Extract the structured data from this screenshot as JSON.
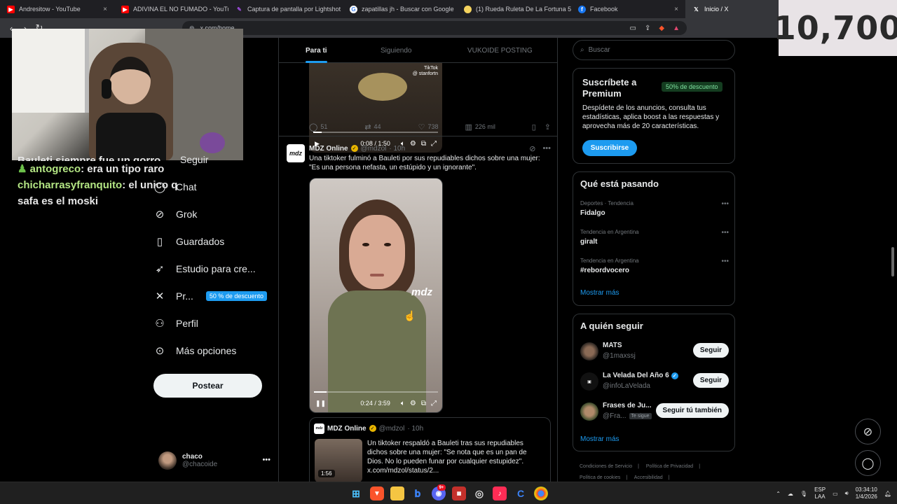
{
  "browser": {
    "tabs": [
      {
        "title": "Andresitow - YouTube",
        "favicon": "youtube-icon",
        "color": "#ff0000"
      },
      {
        "title": "ADIVINA EL NO FUMADO - YouTube",
        "favicon": "youtube-icon",
        "color": "#ff0000"
      },
      {
        "title": "Captura de pantalla por Lightshot",
        "favicon": "lightshot-icon",
        "color": "#a04ee0"
      },
      {
        "title": "zapatillas jh - Buscar con Google",
        "favicon": "google-icon",
        "color": "#ffffff"
      },
      {
        "title": "(1) Rueda Ruleta De La Fortuna 50 C",
        "favicon": "wheel-icon",
        "color": "#f4d35e"
      },
      {
        "title": "Facebook",
        "favicon": "facebook-icon",
        "color": "#1877f2"
      },
      {
        "title": "Inicio / X",
        "favicon": "x-icon",
        "color": "#000000",
        "active": true
      }
    ],
    "url": "x.com/home"
  },
  "overlay": {
    "score": "10,700",
    "chat": {
      "partial_line": "Bauleti siempre fue un gorro",
      "messages": [
        {
          "user": "antogreco",
          "text": ": era un tipo raro"
        },
        {
          "user": "chicharrasyfranquito",
          "text": ": el unico q safa es el moski"
        }
      ]
    }
  },
  "nav": {
    "items": [
      {
        "label": "Seguir",
        "icon": "follow-icon"
      },
      {
        "label": "Chat",
        "icon": "chat-icon"
      },
      {
        "label": "Grok",
        "icon": "grok-icon"
      },
      {
        "label": "Guardados",
        "icon": "bookmark-icon"
      },
      {
        "label": "Estudio para cre...",
        "icon": "rocket-icon"
      },
      {
        "label": "Pr...",
        "icon": "x-logo-icon",
        "badge": "50 % de descuento"
      },
      {
        "label": "Perfil",
        "icon": "profile-icon"
      },
      {
        "label": "Más opciones",
        "icon": "more-icon"
      }
    ],
    "post_button": "Postear",
    "account": {
      "name": "chaco",
      "handle": "@chacoide"
    }
  },
  "feed": {
    "tabs": [
      "Para ti",
      "Siguiendo",
      "VUKOIDE POSTING"
    ],
    "video1": {
      "time": "0:08 / 1:50",
      "progress": 0.07,
      "watermark": "TikTok",
      "watermark_user": "@ stanfortn"
    },
    "actions1": {
      "replies": "51",
      "reposts": "44",
      "likes": "738",
      "views": "226 mil"
    },
    "tweet2": {
      "name": "MDZ Online",
      "handle": "@mdzol",
      "time": "· 10h",
      "avatar_text": "mdz",
      "text": "Una tiktoker fulminó a Bauleti por sus repudiables dichos sobre una mujer: \"Es una persona nefasta, un estúpido y un ignorante\".",
      "video_time": "0:24 / 3:59",
      "video_progress": 0.1,
      "video_mark": "mdz"
    },
    "quote": {
      "name": "MDZ Online",
      "handle": "@mdzol",
      "time": "· 10h",
      "avatar_text": "mdz",
      "duration": "1:56",
      "text": "Un tiktoker respaldó a Bauleti tras sus repudiables dichos sobre una mujer: \"Se nota que es un pan de Dios. No lo pueden funar por cualquier estupidez\". x.com/mdzol/status/2..."
    }
  },
  "right": {
    "search_placeholder": "Buscar",
    "premium": {
      "title": "Suscríbete a Premium",
      "badge": "50% de descuento",
      "desc": "Despídete de los anuncios, consulta tus estadísticas, aplica boost a las respuestas y aprovecha más de 20 características.",
      "button": "Suscribirse"
    },
    "trends": {
      "title": "Qué está pasando",
      "items": [
        {
          "context": "Deportes · Tendencia",
          "name": "Fidalgo"
        },
        {
          "context": "Tendencia en Argentina",
          "name": "giralt"
        },
        {
          "context": "Tendencia en Argentina",
          "name": "#rebordvocero"
        }
      ],
      "more": "Mostrar más"
    },
    "follow": {
      "title": "A quién seguir",
      "items": [
        {
          "name": "MATS",
          "handle": "@1maxssj",
          "button": "Seguir",
          "verified": false
        },
        {
          "name": "La Velada Del Año 6",
          "handle": "@infoLaVelada",
          "button": "Seguir",
          "verified": true
        },
        {
          "name": "Frases de Ju...",
          "handle": "@Fra...",
          "badge": "Te sigue",
          "button": "Seguir tú también",
          "verified": false
        }
      ],
      "more": "Mostrar más"
    },
    "footer": [
      "Condiciones de Servicio",
      "|",
      "Política de Privacidad",
      "|",
      "Política de cookies",
      "|",
      "Accesibilidad",
      "|"
    ]
  },
  "taskbar": {
    "lang1": "ESP",
    "lang2": "LAA",
    "time": "03:34:10",
    "date": "1/4/2026",
    "badge": "9+"
  }
}
